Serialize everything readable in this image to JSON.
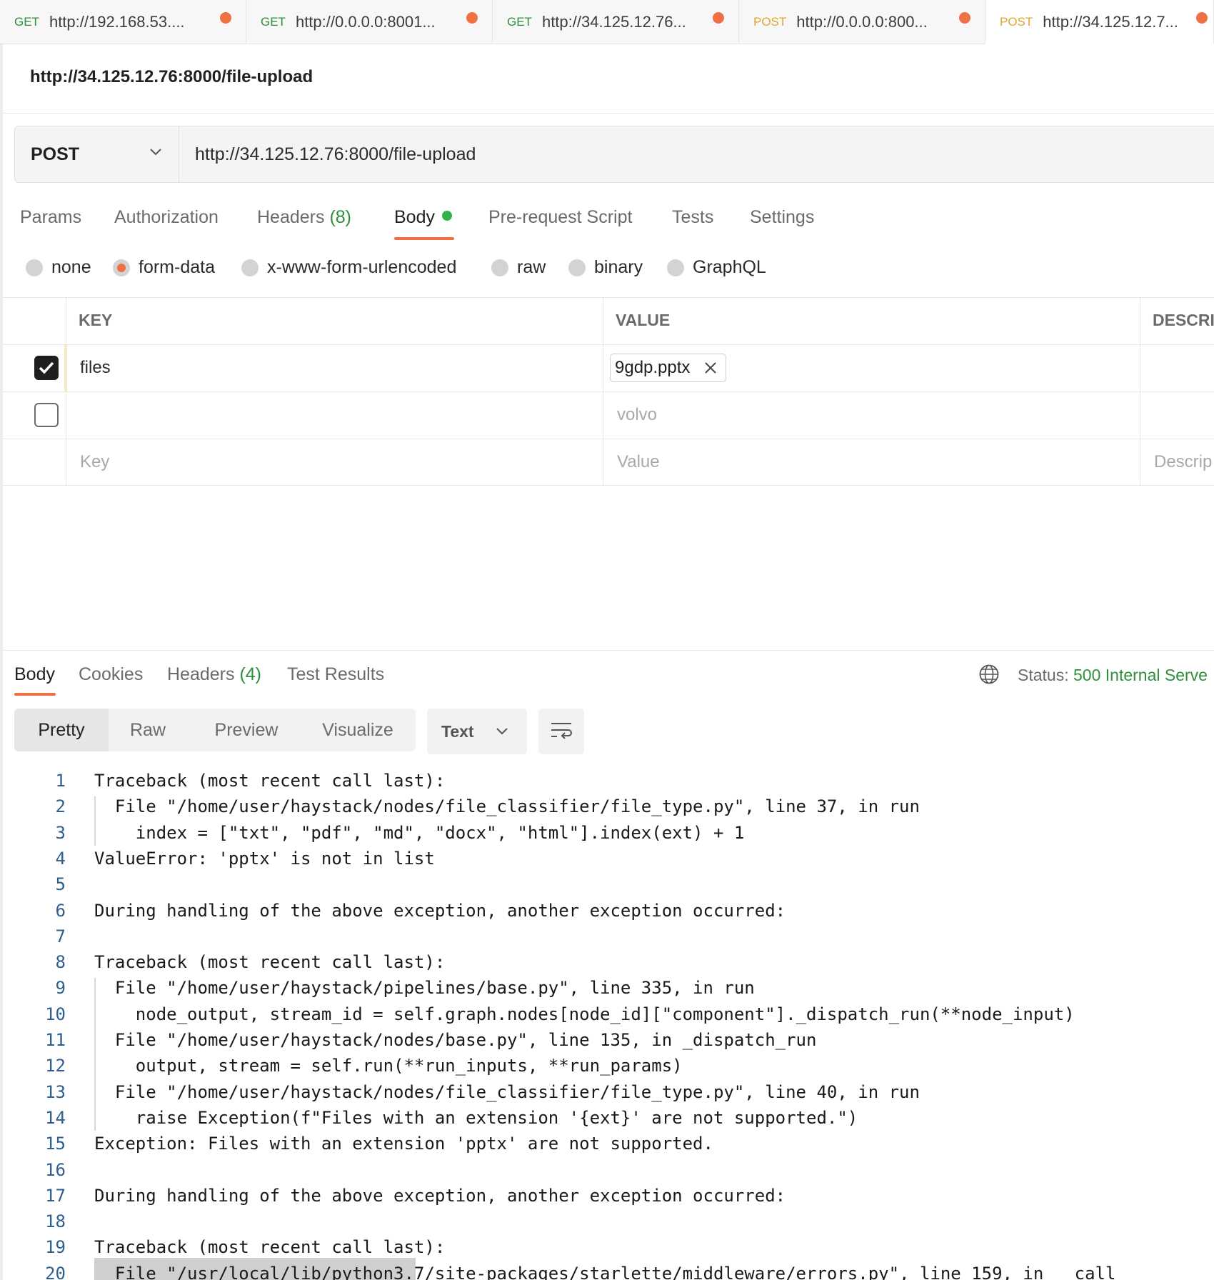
{
  "request_tabs": [
    {
      "method": "GET",
      "url": "http://192.168.53...."
    },
    {
      "method": "GET",
      "url": "http://0.0.0.0:8001..."
    },
    {
      "method": "GET",
      "url": "http://34.125.12.76..."
    },
    {
      "method": "POST",
      "url": "http://0.0.0.0:800..."
    },
    {
      "method": "POST",
      "url": "http://34.125.12.7..."
    }
  ],
  "title": "http://34.125.12.76:8000/file-upload",
  "request": {
    "method": "POST",
    "url": "http://34.125.12.76:8000/file-upload"
  },
  "req_tabs": {
    "params": "Params",
    "authorization": "Authorization",
    "headers": "Headers",
    "headers_count": "(8)",
    "body": "Body",
    "prerequest": "Pre-request Script",
    "tests": "Tests",
    "settings": "Settings"
  },
  "body_types": {
    "none": "none",
    "form_data": "form-data",
    "urlencoded": "x-www-form-urlencoded",
    "raw": "raw",
    "binary": "binary",
    "graphql": "GraphQL",
    "selected": "form-data"
  },
  "form_table": {
    "col_key": "KEY",
    "col_value": "VALUE",
    "col_desc": "DESCRI",
    "rows": [
      {
        "checked": true,
        "key": "files",
        "value": "9gdp.pptx"
      },
      {
        "checked": false,
        "key": "",
        "value": "volvo"
      }
    ],
    "placeholder_key": "Key",
    "placeholder_value": "Value",
    "placeholder_desc": "Descrip"
  },
  "response_tabs": {
    "body": "Body",
    "cookies": "Cookies",
    "headers": "Headers",
    "headers_count": "(4)",
    "test_results": "Test Results"
  },
  "status": {
    "label": "Status:",
    "value": "500 Internal Serve"
  },
  "view_modes": {
    "pretty": "Pretty",
    "raw": "Raw",
    "preview": "Preview",
    "visualize": "Visualize"
  },
  "format": "Text",
  "code_lines": [
    "Traceback (most recent call last):",
    "  File \"/home/user/haystack/nodes/file_classifier/file_type.py\", line 37, in run",
    "    index = [\"txt\", \"pdf\", \"md\", \"docx\", \"html\"].index(ext) + 1",
    "ValueError: 'pptx' is not in list",
    "",
    "During handling of the above exception, another exception occurred:",
    "",
    "Traceback (most recent call last):",
    "  File \"/home/user/haystack/pipelines/base.py\", line 335, in run",
    "    node_output, stream_id = self.graph.nodes[node_id][\"component\"]._dispatch_run(**node_input)",
    "  File \"/home/user/haystack/nodes/base.py\", line 135, in _dispatch_run",
    "    output, stream = self.run(**run_inputs, **run_params)",
    "  File \"/home/user/haystack/nodes/file_classifier/file_type.py\", line 40, in run",
    "    raise Exception(f\"Files with an extension '{ext}' are not supported.\")",
    "Exception: Files with an extension 'pptx' are not supported.",
    "",
    "During handling of the above exception, another exception occurred:",
    "",
    "Traceback (most recent call last):",
    "  File \"/usr/local/lib/python3.7/site-packages/starlette/middleware/errors.py\", line 159, in __call"
  ],
  "colors": {
    "accent": "#ef7143",
    "get": "#2f8f3a",
    "post": "#e0a62a",
    "status_ok_text": "#2f8f3a",
    "body_dot": "#2fb34c"
  }
}
